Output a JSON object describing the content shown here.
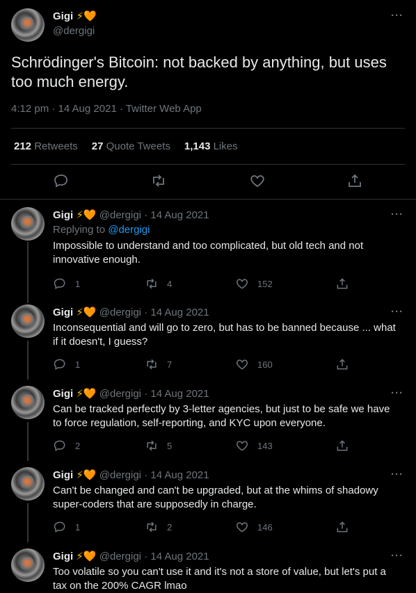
{
  "main": {
    "name": "Gigi",
    "handle": "@dergigi",
    "emoji_bolt": "⚡",
    "emoji_heart": "🧡",
    "more": "···",
    "text": "Schrödinger's Bitcoin: not backed by anything, but uses too much energy.",
    "meta": "4:12 pm · 14 Aug 2021 · Twitter Web App",
    "stats": {
      "retweets_count": "212",
      "retweets_label": "Retweets",
      "quotes_count": "27",
      "quotes_label": "Quote Tweets",
      "likes_count": "1,143",
      "likes_label": "Likes"
    }
  },
  "replies": [
    {
      "name": "Gigi",
      "handle": "@dergigi",
      "sep": "·",
      "date": "14 Aug 2021",
      "replying_prefix": "Replying to",
      "replying_to": "@dergigi",
      "text": "Impossible to understand and too complicated, but old tech and not innovative enough.",
      "replies": "1",
      "retweets": "4",
      "likes": "152"
    },
    {
      "name": "Gigi",
      "handle": "@dergigi",
      "sep": "·",
      "date": "14 Aug 2021",
      "text": "Inconsequential and will go to zero, but has to be banned because ... what if it doesn't, I guess?",
      "replies": "1",
      "retweets": "7",
      "likes": "160"
    },
    {
      "name": "Gigi",
      "handle": "@dergigi",
      "sep": "·",
      "date": "14 Aug 2021",
      "text": "Can be tracked perfectly by 3-letter agencies, but just to be safe we have to force regulation, self-reporting, and KYC upon everyone.",
      "replies": "2",
      "retweets": "5",
      "likes": "143"
    },
    {
      "name": "Gigi",
      "handle": "@dergigi",
      "sep": "·",
      "date": "14 Aug 2021",
      "text": "Can't be changed and can't be upgraded, but at the whims of shadowy super-coders that are supposedly in charge.",
      "replies": "1",
      "retweets": "2",
      "likes": "146"
    },
    {
      "name": "Gigi",
      "handle": "@dergigi",
      "sep": "·",
      "date": "14 Aug 2021",
      "text": "Too volatile so you can't use it and it's not a store of value, but let's put a tax on the 200% CAGR lmao"
    }
  ]
}
